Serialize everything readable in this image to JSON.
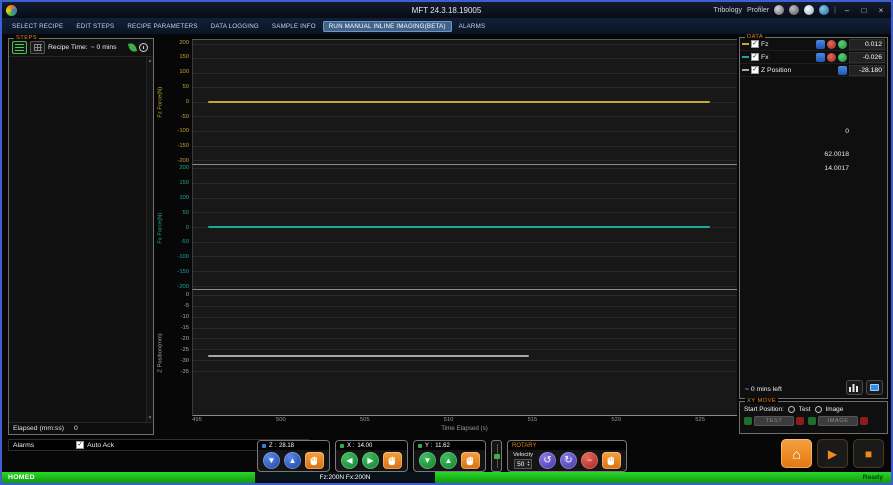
{
  "titlebar": {
    "title": "MFT 24.3.18.19005",
    "mode_left": "Tribology",
    "mode_right": "Profiler"
  },
  "tabs": {
    "items": [
      {
        "label": "SELECT RECIPE",
        "selected": false
      },
      {
        "label": "EDIT STEPS",
        "selected": false
      },
      {
        "label": "RECIPE PARAMETERS",
        "selected": false
      },
      {
        "label": "DATA LOGGING",
        "selected": false
      },
      {
        "label": "SAMPLE INFO",
        "selected": false
      },
      {
        "label": "RUN MANUAL INLINE IMAGING(BETA)",
        "selected": true
      },
      {
        "label": "ALARMS",
        "selected": false
      }
    ]
  },
  "steps": {
    "title": "STEPS",
    "recipe_time_label": "Recipe Time:",
    "recipe_time_value": "~ 0 mins",
    "elapsed_label": "Elapsed (mm:ss)",
    "elapsed_value": "0"
  },
  "alarms": {
    "label": "Alarms",
    "auto_ack_label": "Auto Ack"
  },
  "data_panel": {
    "title": "DATA",
    "channels": [
      {
        "label": "Fz",
        "value": "0.012",
        "color": "#c0a832",
        "checked": true
      },
      {
        "label": "Fx",
        "value": "-0.026",
        "color": "#1fa79b",
        "checked": true
      },
      {
        "label": "Z Position",
        "value": "-28.180",
        "color": "#a8a8a8",
        "checked": true
      }
    ],
    "readouts": [
      {
        "value": "0"
      },
      {
        "value": "62.0018"
      },
      {
        "value": "14.0017"
      }
    ],
    "time_left": "~ 0   mins left"
  },
  "move_panel": {
    "title": "XY MOVE",
    "start_position_label": "Start Position:",
    "options": [
      {
        "label": "Test"
      },
      {
        "label": "Image"
      }
    ],
    "goto_buttons": [
      {
        "label": "TEST"
      },
      {
        "label": "IMAGE"
      }
    ]
  },
  "jog": {
    "z": {
      "label": "Z :",
      "value": "28.18"
    },
    "x": {
      "label": "X :",
      "value": "14.00"
    },
    "y": {
      "label": "Y :",
      "value": "11.62"
    },
    "rotary": {
      "title": "ROTARY",
      "velocity_label": "Velocity",
      "velocity_value": "50"
    }
  },
  "statusbar": {
    "left": "HOMED",
    "center": "Fz:200N Fx:200N",
    "right": "Ready"
  },
  "colors": {
    "accent_orange": "#e8821e",
    "status_green": "#12b412",
    "selected_tab": "#41638a"
  },
  "icons": {
    "window_min": "–",
    "window_max": "□",
    "window_close": "×",
    "check": "✓",
    "down_arrow": "▼",
    "up_arrow": "▲",
    "left_arrow": "◀",
    "right_arrow": "▶",
    "rotate_ccw": "↺",
    "rotate_cw": "↻",
    "minus": "−",
    "home": "⌂",
    "play": "▶",
    "stop": "■",
    "spin_up": "▲",
    "spin_down": "▼",
    "scroll_up": "▲",
    "scroll_down": "▼"
  },
  "chart_data": [
    {
      "type": "line",
      "ylabel": "Fz Force(N)",
      "ylim": [
        -212,
        212
      ],
      "yticks": [
        200,
        150,
        100,
        50,
        0,
        -50,
        -100,
        -150,
        -200
      ],
      "xlim": [
        494.7,
        527.2
      ],
      "series": [
        {
          "name": "Fz",
          "color": "#c0a832",
          "points": [
            [
              495.6,
              0.012
            ],
            [
              525.6,
              0.012
            ]
          ]
        }
      ],
      "grid": true,
      "legend": "none"
    },
    {
      "type": "line",
      "ylabel": "Fx Force(N)",
      "ylim": [
        -212,
        212
      ],
      "yticks": [
        200,
        150,
        100,
        50,
        0,
        -50,
        -100,
        -150,
        -200
      ],
      "xlim": [
        494.7,
        527.2
      ],
      "series": [
        {
          "name": "Fx",
          "color": "#1fa79b",
          "points": [
            [
              495.6,
              -0.026
            ],
            [
              525.6,
              -0.026
            ]
          ]
        }
      ],
      "grid": true,
      "legend": "none"
    },
    {
      "type": "line",
      "ylabel": "Z Position(mm)",
      "xlabel": "Time Elapsed (s)",
      "ylim": [
        -55,
        2
      ],
      "yticks": [
        0,
        -5,
        -10,
        -15,
        -20,
        -25,
        -30,
        -35
      ],
      "xticks": [
        495,
        500,
        505,
        510,
        515,
        520,
        525
      ],
      "xlim": [
        494.7,
        527.2
      ],
      "series": [
        {
          "name": "Z Position",
          "color": "#a8a8a8",
          "points": [
            [
              495.6,
              -28.18
            ],
            [
              514.8,
              -28.18
            ]
          ]
        }
      ],
      "grid": true,
      "legend": "none"
    }
  ]
}
